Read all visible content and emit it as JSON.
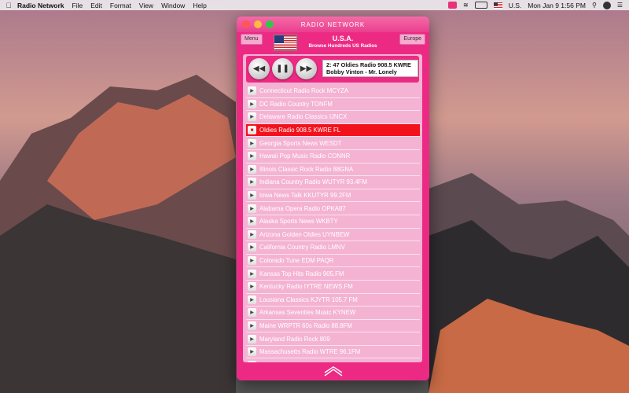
{
  "menubar": {
    "app_name": "Radio Network",
    "menus": [
      "File",
      "Edit",
      "Format",
      "View",
      "Window",
      "Help"
    ],
    "keyboard_layout": "U.S.",
    "datetime": "Mon Jan 9  1:56 PM"
  },
  "window": {
    "title": "RADIO NETWORK"
  },
  "header": {
    "menu_label": "Menu",
    "region_button": "Europe",
    "country": "U.S.A.",
    "subtitle": "Browse Hundreds US Radios"
  },
  "player": {
    "now_playing_line1": "2: 47   Oldies Radio 908.5 KWRE",
    "now_playing_line2": "Bobby Vinton - Mr. Lonely",
    "buttons": [
      "rewind",
      "pause",
      "fast-forward"
    ]
  },
  "stations": [
    {
      "name": "Connecticut Radio Rock MCYZA",
      "active": false
    },
    {
      "name": "DC Radio Country TONFM",
      "active": false
    },
    {
      "name": "Delaware Radio Classics IJNCX",
      "active": false
    },
    {
      "name": "Oldies Radio 908.5 KWRE  FL",
      "active": true
    },
    {
      "name": "Georgia Sports News WESDT",
      "active": false
    },
    {
      "name": "Hawaii Pop Music Radio CONNR",
      "active": false
    },
    {
      "name": "Illinois Classic Rock Radio 88GNA",
      "active": false
    },
    {
      "name": "Indiana Country Radio WUTYR 93.4FM",
      "active": false
    },
    {
      "name": "Iowa News Talk KKUTYR 99.2FM",
      "active": false
    },
    {
      "name": "Alabama Opera Radio OPKA87",
      "active": false
    },
    {
      "name": "Alaska Sports News WKBTY",
      "active": false
    },
    {
      "name": "Arizona Golden Oldies UYNBEW",
      "active": false
    },
    {
      "name": "California Country Radio LMNV",
      "active": false
    },
    {
      "name": "Colorado Tune EDM PAQR",
      "active": false
    },
    {
      "name": "Kansas Top Hits Radio 905.FM",
      "active": false
    },
    {
      "name": "Kentucky Radio IYTRE NEWS.FM",
      "active": false
    },
    {
      "name": "Lousiana Classics KJYTR 105.7 FM",
      "active": false
    },
    {
      "name": "Arkansas Seventies Music KYNEW",
      "active": false
    },
    {
      "name": "Maine WRPTR 60s Radio 88.8FM",
      "active": false
    },
    {
      "name": "Maryland Radio Rock 809",
      "active": false
    },
    {
      "name": "Massachusetts Radio WTRE 96.1FM",
      "active": false
    },
    {
      "name": "",
      "active": false
    }
  ],
  "colors": {
    "accent": "#ec2a84",
    "panel": "#f4b3d3",
    "active_row": "#f2121c"
  }
}
